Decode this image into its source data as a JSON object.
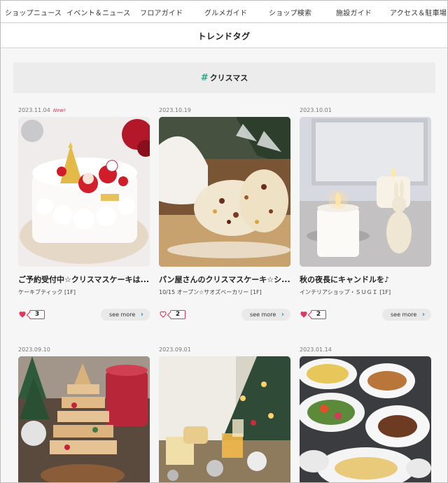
{
  "nav": {
    "items": [
      "ショップニュース",
      "イベント＆ニュース",
      "フロアガイド",
      "グルメガイド",
      "ショップ検索",
      "施設ガイド",
      "アクセス＆駐車場"
    ]
  },
  "header": {
    "title": "トレンドタグ"
  },
  "tag": {
    "hash": "#",
    "label": "クリスマス"
  },
  "see_more_label": "see more",
  "colors": {
    "accent_heart": "#e0375a",
    "hash_green": "#29a98b",
    "chevron": "#2a8fb8"
  },
  "cards": [
    {
      "date": "2023.11.04",
      "badge": "New!",
      "title": "ご予約受付中☆クリスマスケーキは...",
      "shop": "ケーキブティック [1F]",
      "likes": "3",
      "image": "christmas-cake-icon",
      "liked": true
    },
    {
      "date": "2023.10.19",
      "badge": "",
      "title": "パン屋さんのクリスマスケーキ☆シ...",
      "shop": "10/15 オープン☆サオズベーカリー [1F]",
      "likes": "2",
      "image": "stollen-icon",
      "liked": false
    },
    {
      "date": "2023.10.01",
      "badge": "",
      "title": "秋の夜長にキャンドルを♪",
      "shop": "インテリアショップ・ＳＵＧＩ [1F]",
      "likes": "2",
      "image": "candle-icon",
      "liked": true
    },
    {
      "date": "2023.09.10",
      "badge": "",
      "title": "",
      "shop": "",
      "likes": "",
      "image": "cookie-tree-icon",
      "liked": false
    },
    {
      "date": "2023.09.01",
      "badge": "",
      "title": "",
      "shop": "",
      "likes": "",
      "image": "christmas-table-icon",
      "liked": false
    },
    {
      "date": "2023.01.14",
      "badge": "",
      "title": "",
      "shop": "",
      "likes": "",
      "image": "dinner-dishes-icon",
      "liked": false
    }
  ]
}
